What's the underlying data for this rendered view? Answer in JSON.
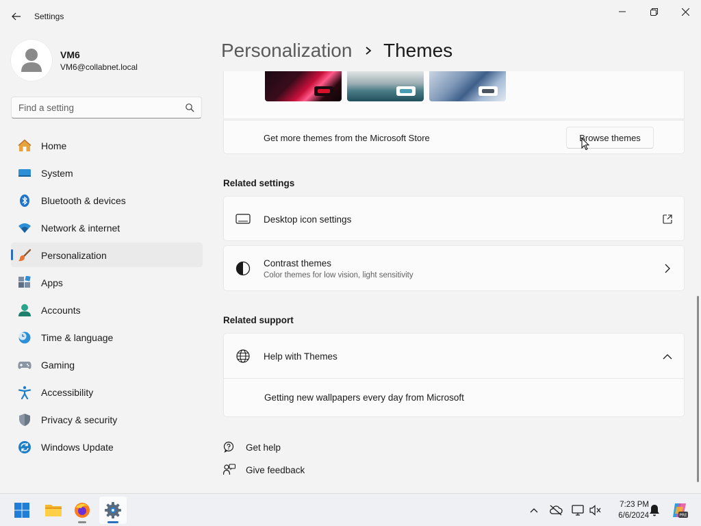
{
  "window": {
    "title": "Settings",
    "controls": [
      "minimize",
      "restore",
      "close"
    ]
  },
  "profile": {
    "name": "VM6",
    "email": "VM6@collabnet.local"
  },
  "search": {
    "placeholder": "Find a setting"
  },
  "sidebar": {
    "items": [
      {
        "label": "Home",
        "icon": "home-icon"
      },
      {
        "label": "System",
        "icon": "system-icon"
      },
      {
        "label": "Bluetooth & devices",
        "icon": "bluetooth-icon"
      },
      {
        "label": "Network & internet",
        "icon": "wifi-icon"
      },
      {
        "label": "Personalization",
        "icon": "brush-icon",
        "selected": true
      },
      {
        "label": "Apps",
        "icon": "apps-icon"
      },
      {
        "label": "Accounts",
        "icon": "accounts-icon"
      },
      {
        "label": "Time & language",
        "icon": "clock-globe-icon"
      },
      {
        "label": "Gaming",
        "icon": "gamepad-icon"
      },
      {
        "label": "Accessibility",
        "icon": "accessibility-icon"
      },
      {
        "label": "Privacy & security",
        "icon": "shield-icon"
      },
      {
        "label": "Windows Update",
        "icon": "update-icon"
      }
    ]
  },
  "header": {
    "parent": "Personalization",
    "current": "Themes"
  },
  "themes": {
    "store_text": "Get more themes from the Microsoft Store",
    "browse_label": "Browse themes"
  },
  "related_settings": {
    "title": "Related settings",
    "desktop_icons": "Desktop icon settings",
    "contrast_title": "Contrast themes",
    "contrast_sub": "Color themes for low vision, light sensitivity"
  },
  "related_support": {
    "title": "Related support",
    "help_title": "Help with Themes",
    "link": "Getting new wallpapers every day from Microsoft"
  },
  "footer_links": {
    "get_help": "Get help",
    "give_feedback": "Give feedback"
  },
  "taskbar": {
    "time": "7:23 PM",
    "date": "6/6/2024",
    "accent": "#2a6fbd"
  }
}
